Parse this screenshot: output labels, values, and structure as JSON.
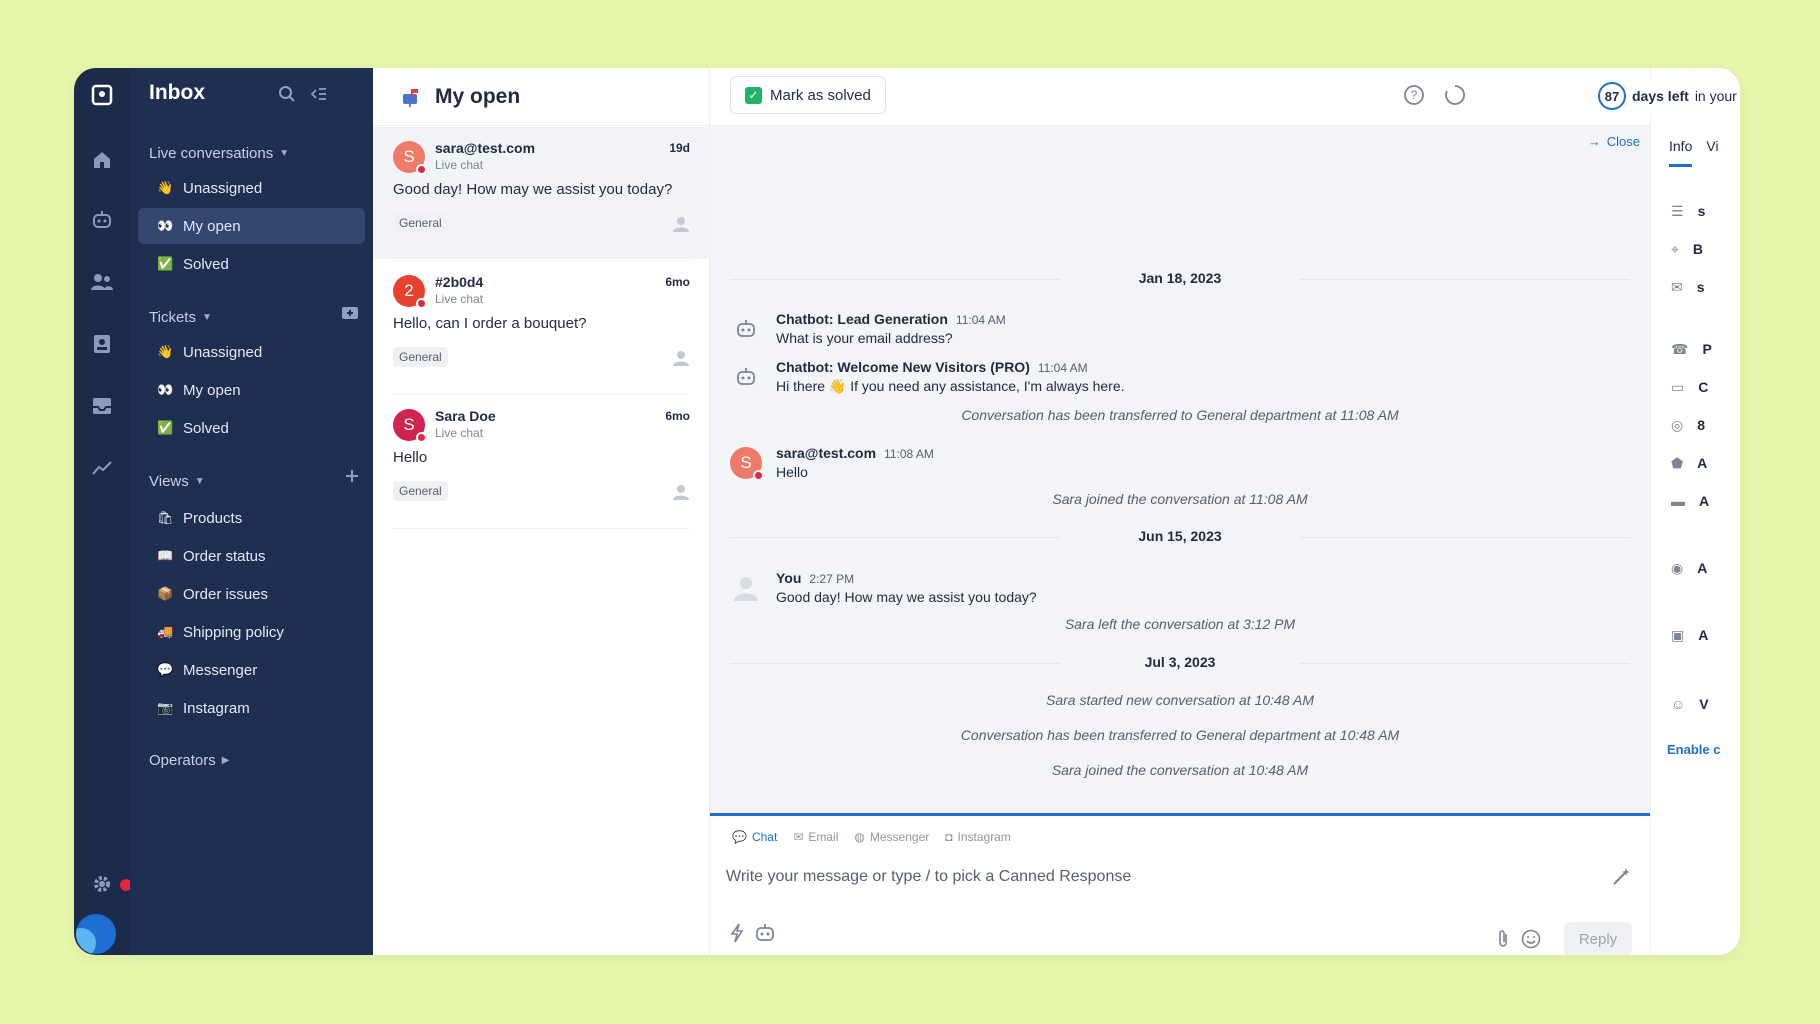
{
  "colors": {
    "background": "#e6f7ac",
    "rail": "#1c2b4a",
    "sidebar": "#1f2f52",
    "accent": "#1f6ed4",
    "danger": "#e8253c",
    "success": "#22b36a"
  },
  "rail": {
    "icons": [
      "logo-icon",
      "home-icon",
      "bot-icon",
      "contacts-icon",
      "tickets-icon",
      "inbox-icon",
      "analytics-icon",
      "settings-icon"
    ]
  },
  "sidebar": {
    "title": "Inbox",
    "live": {
      "label": "Live conversations",
      "items": [
        {
          "label": "Unassigned",
          "emoji": "👋"
        },
        {
          "label": "My open",
          "emoji": "👀"
        },
        {
          "label": "Solved",
          "emoji": "✅"
        }
      ]
    },
    "tickets": {
      "label": "Tickets",
      "items": [
        {
          "label": "Unassigned",
          "emoji": "👋"
        },
        {
          "label": "My open",
          "emoji": "👀"
        },
        {
          "label": "Solved",
          "emoji": "✅"
        }
      ]
    },
    "views": {
      "label": "Views",
      "items": [
        {
          "label": "Products",
          "emoji": "🛍"
        },
        {
          "label": "Order status",
          "emoji": "📖"
        },
        {
          "label": "Order issues",
          "emoji": "📦"
        },
        {
          "label": "Shipping policy",
          "emoji": "🚚"
        },
        {
          "label": "Messenger",
          "emoji": "💬"
        },
        {
          "label": "Instagram",
          "emoji": "📷"
        }
      ]
    },
    "operators": "Operators"
  },
  "list": {
    "title": "My open",
    "conversations": [
      {
        "initial": "S",
        "name": "sara@test.com",
        "channel": "Live chat",
        "time": "19d",
        "message": "Good day! How may we assist you today?",
        "tag": "General",
        "color": "#f07a68"
      },
      {
        "initial": "2",
        "name": "#2b0d4",
        "channel": "Live chat",
        "time": "6mo",
        "message": "Hello, can I order a bouquet?",
        "tag": "General",
        "color": "#e8412f"
      },
      {
        "initial": "S",
        "name": "Sara Doe",
        "channel": "Live chat",
        "time": "6mo",
        "message": "Hello",
        "tag": "General",
        "color": "#d1234f"
      }
    ]
  },
  "main": {
    "mark_solved": "Mark as solved",
    "close": "Close",
    "dates": [
      "Jan 18, 2023",
      "Jun 15, 2023",
      "Jul 3, 2023"
    ],
    "messages": [
      {
        "who": "Chatbot: Lead Generation",
        "time": "11:04 AM",
        "text": "What is your email address?"
      },
      {
        "who": "Chatbot: Welcome New Visitors (PRO)",
        "time": "11:04 AM",
        "text": "Hi there 👋 If you need any assistance, I'm always here."
      },
      {
        "who": "sara@test.com",
        "time": "11:08 AM",
        "text": "Hello",
        "initial": "S"
      },
      {
        "who": "You",
        "time": "2:27 PM",
        "text": "Good day! How may we assist you today?"
      }
    ],
    "system": [
      "Conversation has been transferred to General department at 11:08 AM",
      "Sara joined the conversation at 11:08 AM",
      "Sara left the conversation at 3:12 PM",
      "Sara started new conversation at 10:48 AM",
      "Conversation has been transferred to General department at 10:48 AM",
      "Sara joined the conversation at 10:48 AM"
    ],
    "composer": {
      "channels": [
        "Chat",
        "Email",
        "Messenger",
        "Instagram"
      ],
      "placeholder": "Write your message or type / to pick a Canned Response",
      "reply": "Reply"
    }
  },
  "trial": {
    "days": "87",
    "bold": "days left",
    "text": "in your full-featured"
  },
  "right_panel": {
    "tabs": [
      "Info",
      "Vi"
    ],
    "rows": [
      {
        "icon": "user-icon",
        "text": "s"
      },
      {
        "icon": "location-icon",
        "text": "B"
      },
      {
        "icon": "mail-icon",
        "text": "s"
      },
      {
        "icon": "phone-icon",
        "text": "P"
      },
      {
        "icon": "computer-icon",
        "text": "C"
      },
      {
        "icon": "target-icon",
        "text": "8"
      },
      {
        "icon": "tag-icon",
        "text": "A"
      },
      {
        "icon": "folder-icon",
        "text": "A"
      }
    ],
    "cards": [
      {
        "icon": "person-icon",
        "text": "A"
      },
      {
        "icon": "ticket-icon",
        "text": "A"
      },
      {
        "icon": "smile-icon",
        "text": "V"
      }
    ],
    "enable": "Enable c"
  }
}
